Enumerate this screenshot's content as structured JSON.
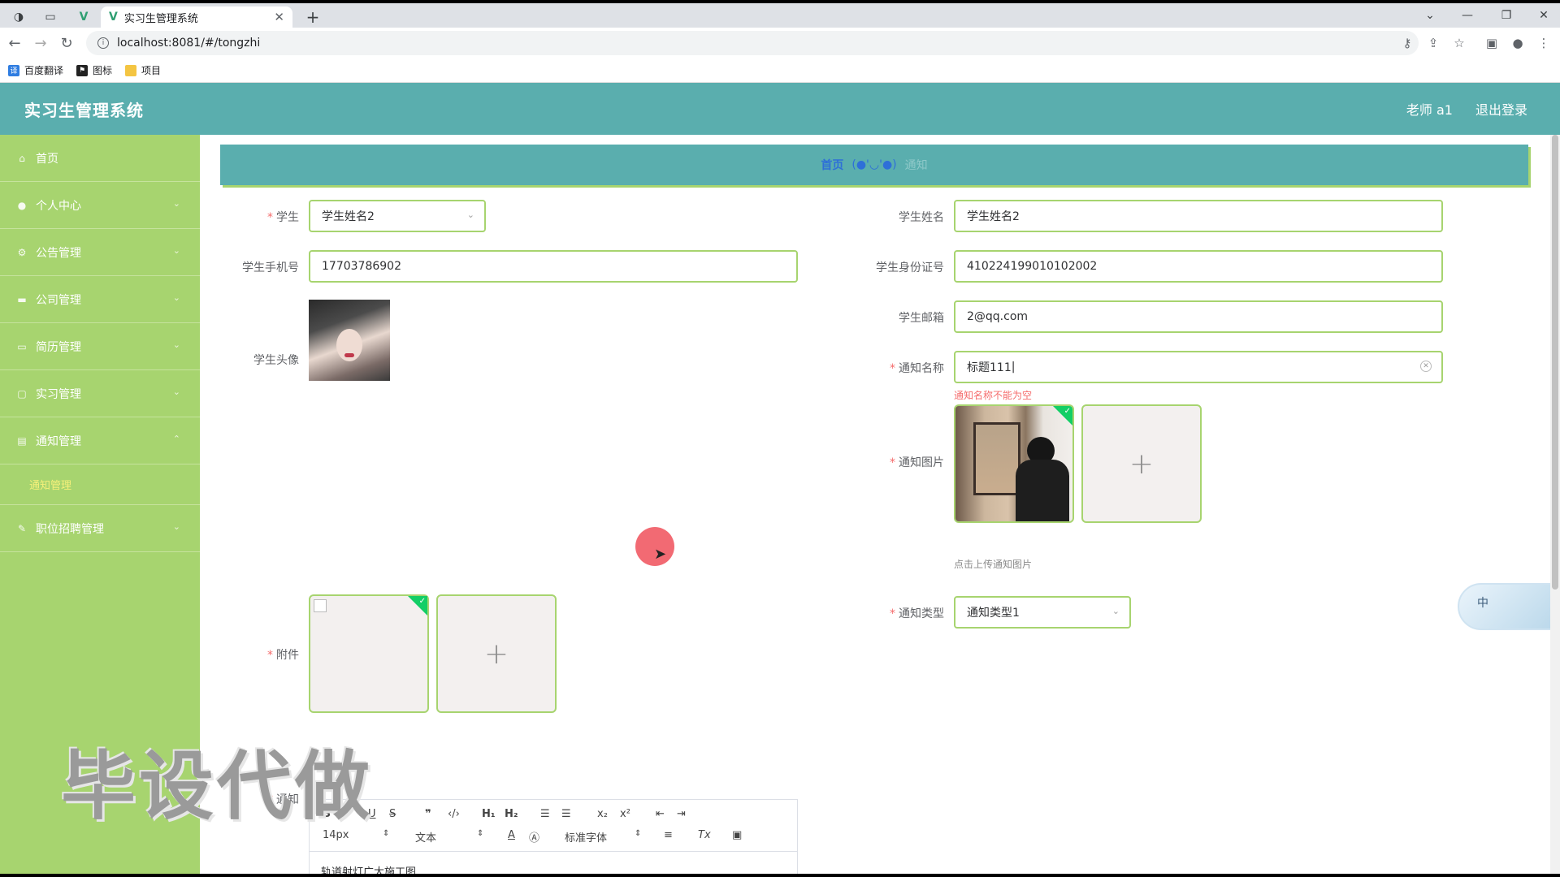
{
  "browser": {
    "tab_title": "实习生管理系统",
    "url": "localhost:8081/#/tongzhi",
    "bookmarks": [
      {
        "label": "百度翻译",
        "icon": "translate-icon",
        "color": "#2f7de1"
      },
      {
        "label": "图标",
        "icon": "flag-icon",
        "color": "#222222"
      },
      {
        "label": "项目",
        "icon": "folder-icon",
        "color": "#f4c542"
      }
    ]
  },
  "app": {
    "title": "实习生管理系统",
    "user": "老师 a1",
    "logout": "退出登录",
    "header_color": "#5aaeae",
    "sidebar_color": "#a7d46f"
  },
  "sidebar": {
    "items": [
      {
        "label": "首页",
        "icon": "home-icon"
      },
      {
        "label": "个人中心",
        "icon": "user-icon"
      },
      {
        "label": "公告管理",
        "icon": "settings-icon"
      },
      {
        "label": "公司管理",
        "icon": "building-icon"
      },
      {
        "label": "简历管理",
        "icon": "monitor-icon"
      },
      {
        "label": "实习管理",
        "icon": "chat-icon"
      },
      {
        "label": "通知管理",
        "icon": "briefcase-icon"
      },
      {
        "label": "职位招聘管理",
        "icon": "edit-icon"
      }
    ],
    "sub_item": "通知管理"
  },
  "breadcrumb": {
    "home": "首页",
    "emoticon": "(●'◡'●)",
    "current": "通知"
  },
  "form": {
    "student_label": "学生",
    "student_value": "学生姓名2",
    "student_name_label": "学生姓名",
    "student_name_value": "学生姓名2",
    "phone_label": "学生手机号",
    "phone_value": "17703786902",
    "id_label": "学生身份证号",
    "id_value": "410224199010102002",
    "avatar_label": "学生头像",
    "email_label": "学生邮箱",
    "email_value": "2@qq.com",
    "notice_name_label": "通知名称",
    "notice_name_value": "标题111",
    "notice_name_error": "通知名称不能为空",
    "notice_image_label": "通知图片",
    "notice_image_tip": "点击上传通知图片",
    "notice_type_label": "通知类型",
    "notice_type_value": "通知类型1",
    "attachment_label": "附件",
    "content_label": "通知",
    "content_value": "轨道射灯广大施工图"
  },
  "editor": {
    "font_size": "14px",
    "text_style": "文本",
    "font_family": "标准字体"
  },
  "overlay": {
    "watermark": "毕设代做",
    "ime_label": "中"
  }
}
